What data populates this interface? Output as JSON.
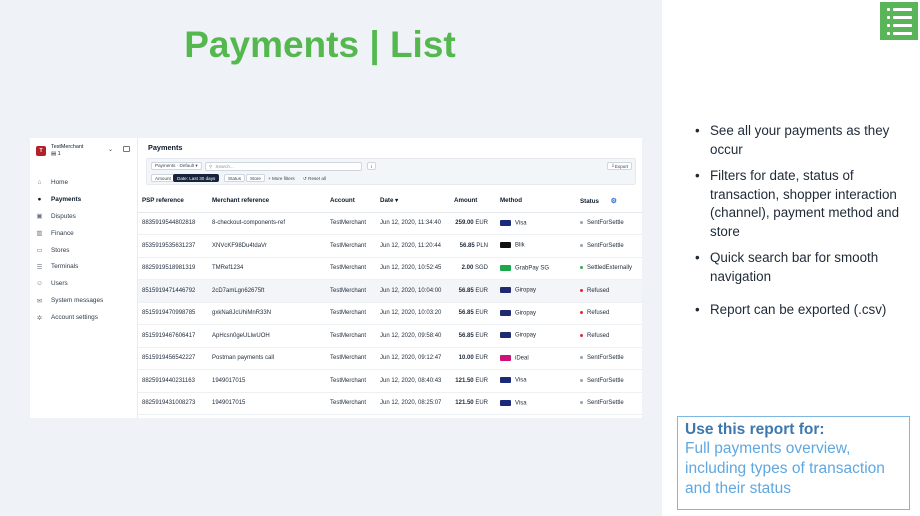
{
  "slide": {
    "title": "Payments | List",
    "menu_icon": "list-icon"
  },
  "app": {
    "merchant_name": "TestMerchant",
    "merchant_initial": "T",
    "merchant_sub": "1",
    "page_heading": "Payments",
    "nav": [
      {
        "label": "Home",
        "icon": "home-icon",
        "glyph": "⌂",
        "active": false
      },
      {
        "label": "Payments",
        "icon": "payments-icon",
        "glyph": "●",
        "active": true
      },
      {
        "label": "Disputes",
        "icon": "disputes-icon",
        "glyph": "▣",
        "active": false
      },
      {
        "label": "Finance",
        "icon": "finance-icon",
        "glyph": "▥",
        "active": false
      },
      {
        "label": "Stores",
        "icon": "stores-icon",
        "glyph": "▭",
        "active": false
      },
      {
        "label": "Terminals",
        "icon": "terminals-icon",
        "glyph": "☰",
        "active": false
      },
      {
        "label": "Users",
        "icon": "users-icon",
        "glyph": "☺",
        "active": false
      },
      {
        "label": "System messages",
        "icon": "messages-icon",
        "glyph": "✉",
        "active": false
      },
      {
        "label": "Account settings",
        "icon": "settings-icon",
        "glyph": "✲",
        "active": false
      }
    ],
    "filters": {
      "view_select": "Payments · Default ▾",
      "search_placeholder": "Search...",
      "export_label": "Export",
      "amount": "Amount",
      "date": "Date: Last 30 days",
      "status": "Status",
      "store": "Store",
      "more_filters": "More filters",
      "reset_all": "Reset all"
    },
    "table": {
      "headers": [
        "PSP reference",
        "Merchant reference",
        "Account",
        "Date ▾",
        "Amount",
        "Method",
        "Status"
      ],
      "rows": [
        {
          "psp": "8835919544802818",
          "merchant_ref": "8-checkout-components-ref",
          "account": "TestMerchant",
          "date": "Jun 12, 2020, 11:34:40",
          "amount": "259.00",
          "currency": "EUR",
          "method": "Visa",
          "method_color": "#1a2a78",
          "status": "SentForSettle",
          "status_color": "#9aa3ad"
        },
        {
          "psp": "8535919535631237",
          "merchant_ref": "XNVcKF98Du4tdaVr",
          "account": "TestMerchant",
          "date": "Jun 12, 2020, 11:20:44",
          "amount": "56.85",
          "currency": "PLN",
          "method": "Blik",
          "method_color": "#111111",
          "status": "SentForSettle",
          "status_color": "#9aa3ad"
        },
        {
          "psp": "8825919518981319",
          "merchant_ref": "TMRef1234",
          "account": "TestMerchant",
          "date": "Jun 12, 2020, 10:52:45",
          "amount": "2.00",
          "currency": "SGD",
          "method": "GrabPay SG",
          "method_color": "#19a84a",
          "status": "SettledExternally",
          "status_color": "#2fae55"
        },
        {
          "psp": "8515919471446792",
          "merchant_ref": "2cD7amLgn62675ft",
          "account": "TestMerchant",
          "date": "Jun 12, 2020, 10:04:00",
          "amount": "56.85",
          "currency": "EUR",
          "method": "Giropay",
          "method_color": "#202a6e",
          "status": "Refused",
          "status_color": "#e0273a"
        },
        {
          "psp": "8515919470998785",
          "merchant_ref": "gxkNa8JcUhiMnR33N",
          "account": "TestMerchant",
          "date": "Jun 12, 2020, 10:03:20",
          "amount": "56.85",
          "currency": "EUR",
          "method": "Giropay",
          "method_color": "#202a6e",
          "status": "Refused",
          "status_color": "#e0273a"
        },
        {
          "psp": "8515919467606417",
          "merchant_ref": "ApHcsn0geULlwUOH",
          "account": "TestMerchant",
          "date": "Jun 12, 2020, 09:58:40",
          "amount": "56.85",
          "currency": "EUR",
          "method": "Giropay",
          "method_color": "#202a6e",
          "status": "Refused",
          "status_color": "#e0273a"
        },
        {
          "psp": "8515919456542227",
          "merchant_ref": "Postman payments call",
          "account": "TestMerchant",
          "date": "Jun 12, 2020, 09:12:47",
          "amount": "10.00",
          "currency": "EUR",
          "method": "iDeal",
          "method_color": "#cc1277",
          "status": "SentForSettle",
          "status_color": "#9aa3ad"
        },
        {
          "psp": "8825919440231163",
          "merchant_ref": "1949017015",
          "account": "TestMerchant",
          "date": "Jun 12, 2020, 08:40:43",
          "amount": "121.50",
          "currency": "EUR",
          "method": "Visa",
          "method_color": "#1a2a78",
          "status": "SentForSettle",
          "status_color": "#9aa3ad"
        },
        {
          "psp": "8825919431008273",
          "merchant_ref": "1949017015",
          "account": "TestMerchant",
          "date": "Jun 12, 2020, 08:25:07",
          "amount": "121.50",
          "currency": "EUR",
          "method": "Visa",
          "method_color": "#1a2a78",
          "status": "SentForSettle",
          "status_color": "#9aa3ad"
        }
      ]
    }
  },
  "bullets": [
    "See all your payments as they occur",
    "Filters for date, status of transaction, shopper interaction (channel), payment method and store",
    "Quick search bar for smooth navigation",
    "Report can be exported (.csv)"
  ],
  "callout": {
    "title": "Use this report for:",
    "body": "Full payments overview, including types of transaction and their status"
  },
  "colors": {
    "title_green": "#55b84f",
    "callout_border": "#7fb7e3",
    "link_blue": "#2f6fd6"
  }
}
